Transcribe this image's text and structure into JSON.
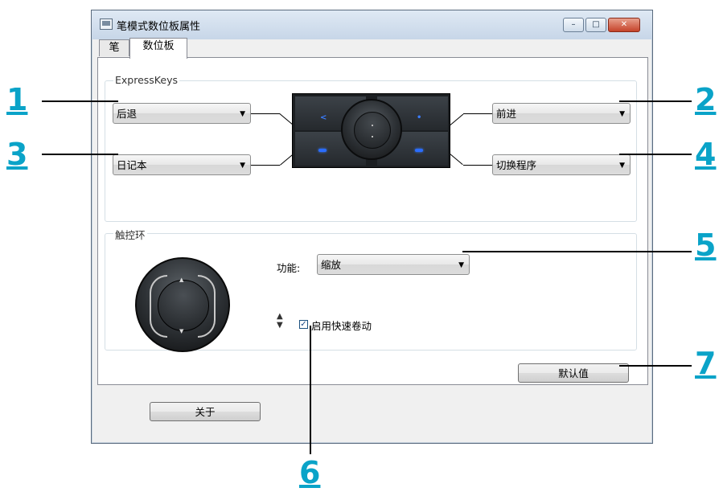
{
  "window": {
    "title": "笔模式数位板属性",
    "controls": {
      "minimize": "–",
      "maximize": "□",
      "close": "✕"
    }
  },
  "tabs": [
    {
      "label": "笔",
      "active": false
    },
    {
      "label": "数位板",
      "active": true
    }
  ],
  "expresskeys": {
    "group_label": "ExpressKeys",
    "key1": "后退",
    "key2": "前进",
    "key3": "日记本",
    "key4": "切换程序"
  },
  "touch_ring": {
    "group_label": "触控环",
    "function_label": "功能:",
    "function_value": "缩放",
    "fast_scroll_label": "启用快速卷动",
    "fast_scroll_checked": true
  },
  "buttons": {
    "default": "默认值",
    "about": "关于"
  },
  "callouts": [
    "1",
    "2",
    "3",
    "4",
    "5",
    "6",
    "7"
  ],
  "colors": {
    "callout": "#0aa3c8",
    "led": "#2a6dff"
  }
}
